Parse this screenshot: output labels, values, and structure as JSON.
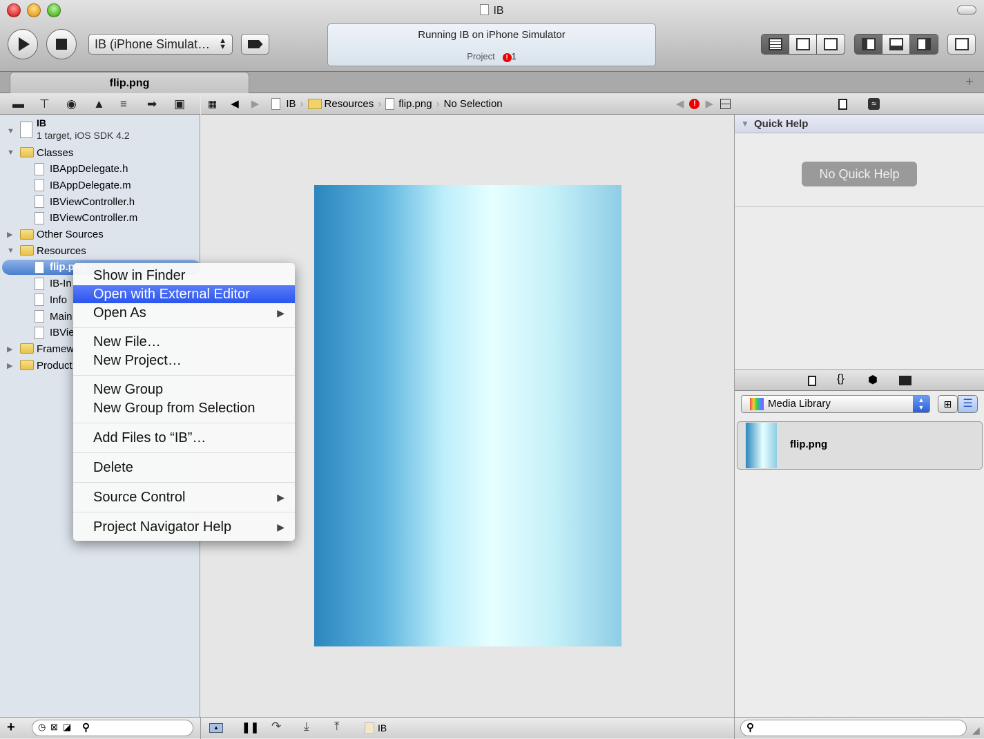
{
  "window": {
    "title": "IB"
  },
  "toolbar": {
    "scheme": "IB (iPhone Simulat…",
    "activity_status": "Running IB on iPhone Simulator",
    "activity_project": "Project",
    "issue_count": "1"
  },
  "tab": {
    "label": "flip.png"
  },
  "jumpbar": {
    "crumbs": [
      "IB",
      "Resources",
      "flip.png",
      "No Selection"
    ]
  },
  "navigator": {
    "project": {
      "name": "IB",
      "subtitle": "1 target, iOS SDK 4.2"
    },
    "items": [
      {
        "label": "Classes",
        "type": "folder",
        "level": 0,
        "expanded": true
      },
      {
        "label": "IBAppDelegate.h",
        "type": "file",
        "level": 1
      },
      {
        "label": "IBAppDelegate.m",
        "type": "file",
        "level": 1
      },
      {
        "label": "IBViewController.h",
        "type": "file",
        "level": 1
      },
      {
        "label": "IBViewController.m",
        "type": "file",
        "level": 1
      },
      {
        "label": "Other Sources",
        "type": "folder",
        "level": 0,
        "expanded": false
      },
      {
        "label": "Resources",
        "type": "folder",
        "level": 0,
        "expanded": true
      },
      {
        "label": "flip.png",
        "type": "image",
        "level": 1,
        "selected": true
      },
      {
        "label": "IB-In",
        "type": "file",
        "level": 1
      },
      {
        "label": "Info",
        "type": "file",
        "level": 1
      },
      {
        "label": "Main",
        "type": "file",
        "level": 1
      },
      {
        "label": "IBVie",
        "type": "file",
        "level": 1
      },
      {
        "label": "Framew",
        "type": "folder",
        "level": 0,
        "expanded": false
      },
      {
        "label": "Product",
        "type": "folder",
        "level": 0,
        "expanded": false
      }
    ]
  },
  "context_menu": {
    "items": [
      {
        "label": "Show in Finder"
      },
      {
        "label": "Open with External Editor",
        "highlighted": true
      },
      {
        "label": "Open As",
        "submenu": true
      },
      {
        "label": "New File…"
      },
      {
        "label": "New Project…"
      },
      {
        "label": "New Group"
      },
      {
        "label": "New Group from Selection"
      },
      {
        "label": "Add Files to “IB”…"
      },
      {
        "label": "Delete"
      },
      {
        "label": "Source Control",
        "submenu": true
      },
      {
        "label": "Project Navigator Help",
        "submenu": true
      }
    ]
  },
  "inspector": {
    "quick_help_title": "Quick Help",
    "no_quick_help": "No Quick Help"
  },
  "library": {
    "selected": "Media Library",
    "items": [
      {
        "label": "flip.png"
      }
    ]
  },
  "debug_bar": {
    "target": "IB"
  },
  "colors": {
    "menu_highlight": "#2a56f0",
    "sidebar_bg": "#dde4ec",
    "error": "#e00000"
  }
}
